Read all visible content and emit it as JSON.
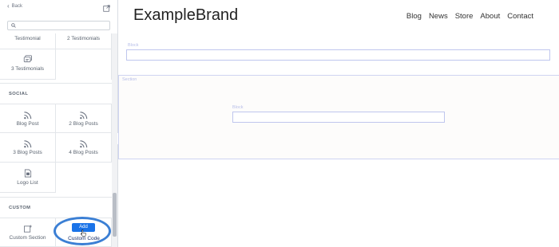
{
  "sidebar": {
    "back_label": "Back",
    "search": {
      "placeholder": ""
    },
    "top_partial": {
      "left_label": "Testimonial",
      "right_label": "2 Testimonials"
    },
    "testimonials_row": {
      "label": "3 Testimonials"
    },
    "social": {
      "heading": "SOCIAL",
      "items": [
        "Blog Post",
        "2 Blog Posts",
        "3 Blog Posts",
        "4 Blog Posts",
        "Logo List"
      ]
    },
    "custom": {
      "heading": "CUSTOM",
      "items": [
        "Custom Section",
        "Custom Code"
      ]
    },
    "add_button": "Add"
  },
  "canvas": {
    "brand": "ExampleBrand",
    "nav": [
      "Blog",
      "News",
      "Store",
      "About",
      "Contact"
    ],
    "labels": {
      "block_top": "Block",
      "section": "Section",
      "block_inner": "Block"
    }
  },
  "colors": {
    "accent": "#1a73e8",
    "highlight_ring": "#3b7fd4",
    "block_border": "#bfc6ee"
  }
}
